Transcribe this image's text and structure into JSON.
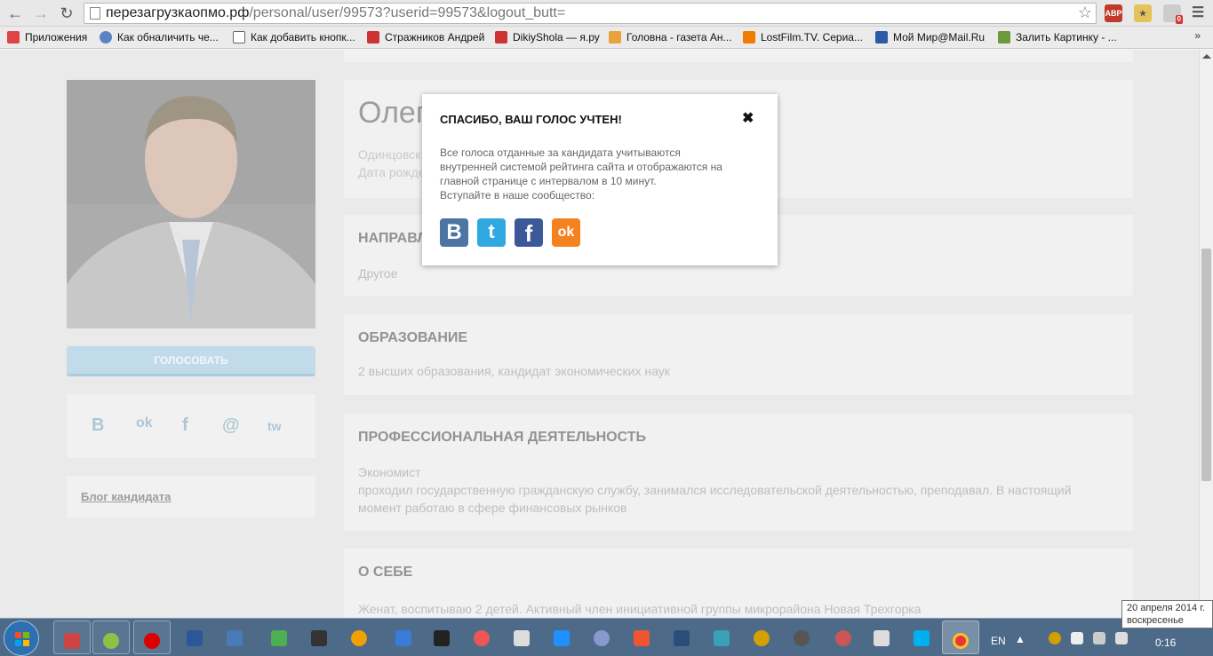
{
  "browser": {
    "url_host": "перезагрузкаопмо.рф",
    "url_path": "/personal/user/99573?userid=99573&logout_butt=",
    "back_icon": "arrow-left-icon",
    "forward_icon": "arrow-right-icon",
    "reload_icon": "reload-icon",
    "star_icon": "star-icon",
    "ext_abp": "ABP",
    "ext_badge": "0"
  },
  "bookmarks": [
    {
      "label": "Приложения",
      "color": "#d44"
    },
    {
      "label": "Как обналичить че...",
      "color": "#5b83c6"
    },
    {
      "label": "Как добавить кнопк...",
      "color": "#444"
    },
    {
      "label": "Стражников Андрей",
      "color": "#c33"
    },
    {
      "label": "DikiyShola — я.ру",
      "color": "#c33"
    },
    {
      "label": "Головна - газета Ан...",
      "color": "#e8a33c"
    },
    {
      "label": "LostFilm.TV. Сериа...",
      "color": "#f07c00"
    },
    {
      "label": "Мой Мир@Mail.Ru",
      "color": "#2a5aa8"
    },
    {
      "label": "Залить Картинку - ...",
      "color": "#6a9a3a"
    }
  ],
  "bookmarks_more": "»",
  "sidebar": {
    "vote_button": "ГОЛОСОВАТЬ",
    "social": [
      "B",
      "ok",
      "f",
      "@",
      "tw"
    ],
    "blog_link": "Блог кандидата"
  },
  "profile": {
    "name": "Олег",
    "location": "Одинцовск",
    "birth": "Дата рожде"
  },
  "sections": [
    {
      "title": "НАПРАВЛ",
      "text": "Другое"
    },
    {
      "title": "ОБРАЗОВАНИЕ",
      "text": "2 высших образования, кандидат экономических наук"
    },
    {
      "title": "ПРОФЕССИОНАЛЬНАЯ ДЕЯТЕЛЬНОСТЬ",
      "text1": "Экономист",
      "text2": "проходил государственную гражданскую службу, занимался исследовательской деятельностью, преподавал. В настоящий",
      "text3": "момент работаю в сфере финансовых рынков"
    },
    {
      "title": "О СЕБЕ",
      "text": "Женат, воспитываю 2 детей. Активный член инициативной группы микрорайона Новая Трехгорка"
    }
  ],
  "modal": {
    "title": "СПАСИБО, ВАШ ГОЛОС УЧТЕН!",
    "close": "✖",
    "line1": "Все голоса отданные за кандидата учитываются",
    "line2": "внутренней системой рейтинга сайта и отображаются на",
    "line3": "главной странице с интервалом в 10 минут.",
    "line4": "Вступайте в наше сообщество:",
    "share": [
      {
        "label": "B",
        "color": "#4c75a3"
      },
      {
        "label": "t",
        "color": "#2fa9e0"
      },
      {
        "label": "f",
        "color": "#3b5998"
      },
      {
        "label": "ok",
        "color": "#f4821f"
      }
    ]
  },
  "taskbar": {
    "lang": "EN",
    "time": "0:16",
    "tooltip_date": "20 апреля 2014 г.",
    "tooltip_day": "воскресенье"
  }
}
